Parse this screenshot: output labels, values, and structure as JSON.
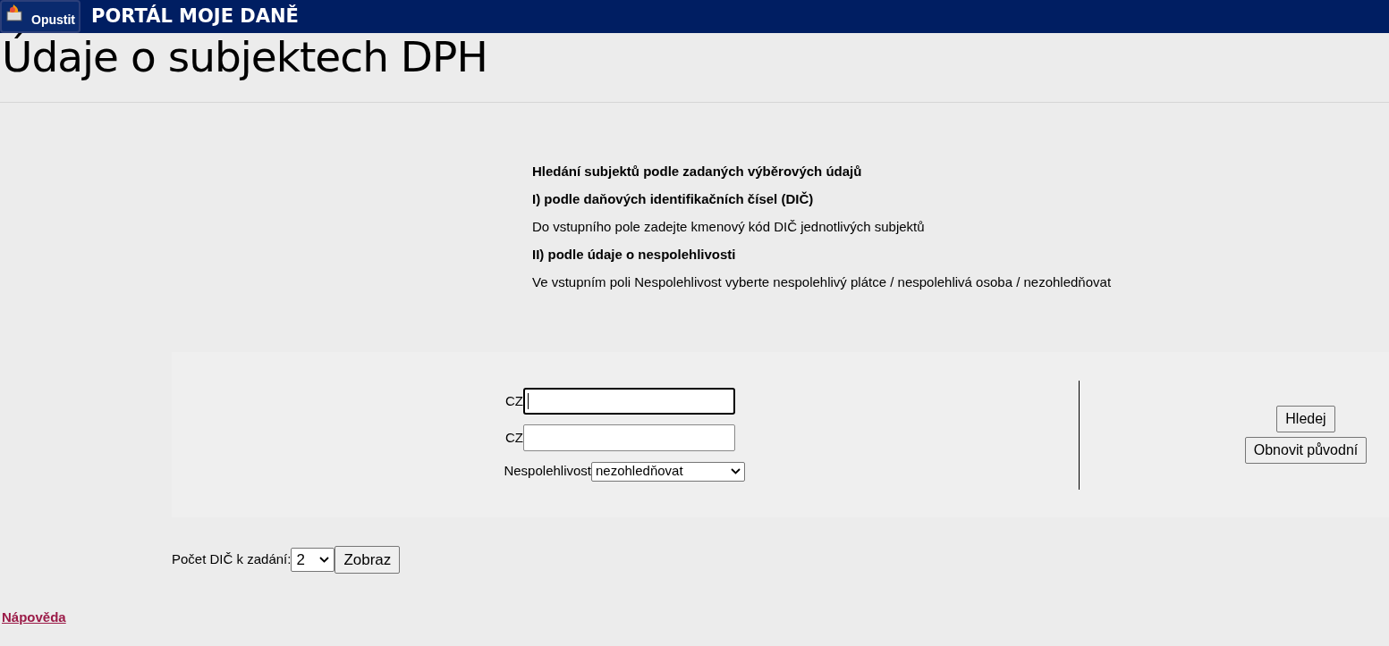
{
  "header": {
    "exit_button": "Opustit",
    "title": "PORTÁL MOJE DANĚ"
  },
  "page_title": "Údaje o subjektech DPH",
  "info": [
    {
      "kind": "heading",
      "text": "Hledání subjektů podle zadaných výběrových údajů"
    },
    {
      "kind": "heading",
      "text": "I) podle daňových identifikačních čísel (DIČ)"
    },
    {
      "kind": "text",
      "text": "Do vstupního pole zadejte kmenový kód DIČ jednotlivých subjektů"
    },
    {
      "kind": "heading",
      "text": "II) podle údaje o nespolehlivosti"
    },
    {
      "kind": "text",
      "text": "Ve vstupním poli Nespolehlivost vyberte nespolehlivý plátce / nespolehlivá osoba / nezohledňovat"
    }
  ],
  "form": {
    "dic_fields": [
      {
        "prefix": "CZ",
        "focused": true
      },
      {
        "prefix": "CZ",
        "focused": false
      }
    ],
    "unreliability": {
      "label": "Nespolehlivost",
      "value": "nezohledňovat"
    },
    "buttons": [
      "Hledej",
      "Obnovit původní"
    ]
  },
  "count": {
    "label": "Počet DIČ k zadání:",
    "value": "2",
    "button": "Zobraz"
  },
  "help_link": "Nápověda"
}
